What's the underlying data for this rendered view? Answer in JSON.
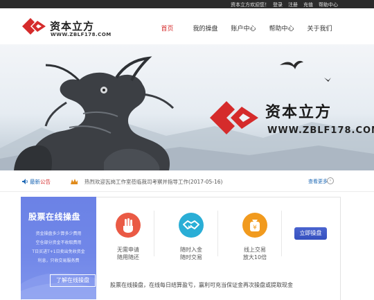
{
  "topbar": {
    "welcome": "资本立方欢迎您！",
    "links": [
      "登录",
      "注册",
      "充值",
      "帮助中心"
    ]
  },
  "brand": {
    "name": "资本立方",
    "url": "WWW.ZBLF178.COM",
    "color": "#d52b2b"
  },
  "nav": {
    "items": [
      {
        "label": "首页",
        "active": true
      },
      {
        "label": "我的操盘",
        "active": false
      },
      {
        "label": "账户中心",
        "active": false
      },
      {
        "label": "帮助中心",
        "active": false
      },
      {
        "label": "关于我们",
        "active": false
      }
    ]
  },
  "banner": {
    "brand": "资本立方",
    "url": "WWW.ZBLF178.COM"
  },
  "notice": {
    "label_a": "最新",
    "label_b": "公告",
    "text": "热烈欢迎瓦岗工作室莅临我司考察并指导工作(2017-05-16)",
    "more": "查看更多"
  },
  "promo": {
    "title": "股票在线操盘",
    "lines": [
      "资金操盘多少算多少费用",
      "空仓部分资金不收取费用",
      "T日买进T+1日卖出免收资金",
      "利息，只收交易服务费"
    ],
    "button": "了解在线操盘"
  },
  "features": [
    {
      "icon": "hand-icon",
      "line1": "无需申请",
      "line2": "随用随还"
    },
    {
      "icon": "handshake-icon",
      "line1": "随时入金",
      "line2": "随时交易"
    },
    {
      "icon": "money-bag-icon",
      "line1": "线上交易",
      "line2": "放大10倍"
    }
  ],
  "apply_button": "立即操盘",
  "description": "股票在线操盘，在线每日结算盈亏，赢利可充当保证金再次操盘或提取现金"
}
